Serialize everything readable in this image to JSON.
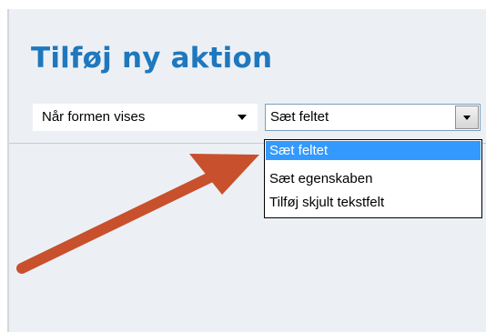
{
  "header": {
    "title": "Tilføj ny aktion"
  },
  "event_select": {
    "value": "Når formen vises"
  },
  "action_select": {
    "value": "Sæt feltet",
    "options": [
      {
        "label": "Sæt feltet",
        "selected": true
      },
      {
        "label": "Sæt egenskaben",
        "selected": false
      },
      {
        "label": "Tilføj skjult tekstfelt",
        "selected": false
      }
    ]
  },
  "colors": {
    "title": "#1f78bd",
    "panel": "#ecf0f5",
    "selected_option": "#3399ff",
    "annotation_arrow": "#c8502d"
  },
  "annotation": {
    "icon": "pointer-arrow-icon"
  }
}
